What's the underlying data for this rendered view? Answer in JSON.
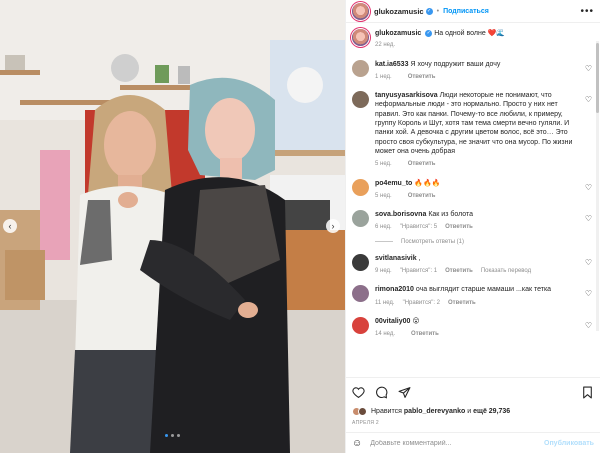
{
  "post": {
    "username": "glukozamusic",
    "dot": "•",
    "follow_label": "Подписаться",
    "more_label": "•••",
    "caption": {
      "text": "На одной волне",
      "emojis": "❤️🌊",
      "time": "22 нед."
    },
    "photo": {
      "slide_count": 3,
      "active_slide": 1
    }
  },
  "comments": [
    {
      "username": "kat.ia6533",
      "text": "Я хочу подружит ваши дочу",
      "time": "1 нед.",
      "likes": "",
      "reply": "Ответить",
      "translate": ""
    },
    {
      "username": "tanyusyasarkisova",
      "text": "Люди некоторые не понимают, что неформальные люди - это нормально. Просто у них нет правил. Это как панки. Почему-то все любили, к примеру, группу Король и Шут, хотя там тема смерти вечно гуляли. И панки хой. А девочка с другим цветом волос, всё это… Это просто своя субкультура, не значит что она мусор. По жизни может она очень добрая",
      "time": "5 нед.",
      "likes": "",
      "reply": "Ответить",
      "translate": ""
    },
    {
      "username": "po4emu_to",
      "text": "🔥🔥🔥",
      "time": "5 нед.",
      "likes": "",
      "reply": "Ответить",
      "translate": ""
    },
    {
      "username": "sova.borisovna",
      "text": "Как из болота",
      "time": "6 нед.",
      "likes": "\"Нравится\": 5",
      "reply": "Ответить",
      "translate": ""
    },
    {
      "username": "svitlanasivik",
      "text": ",",
      "time": "9 нед.",
      "likes": "\"Нравится\": 1",
      "reply": "Ответить",
      "translate": "Показать перевод"
    },
    {
      "username": "rimona2010",
      "text": "оча выглядит старше мамаши ...как тетка",
      "time": "11 нед.",
      "likes": "\"Нравится\": 2",
      "reply": "Ответить",
      "translate": ""
    },
    {
      "username": "00vitaliy00",
      "text": "😮",
      "time": "14 нед.",
      "likes": "",
      "reply": "Ответить",
      "translate": ""
    }
  ],
  "view_replies": "Посмотреть ответы (1)",
  "likes_line": {
    "prefix": "Нравится",
    "user": "pablo_derevyanko",
    "middle": "и",
    "rest": "ещё 29,736"
  },
  "date": "АПРЕЛЯ 2",
  "add_comment": {
    "placeholder": "Добавьте комментарий...",
    "publish": "Опубликовать"
  },
  "colors": {
    "accent": "#0095f6",
    "verified": "#3897f0",
    "muted": "#8e8e8e",
    "heart": "#ed4956"
  }
}
